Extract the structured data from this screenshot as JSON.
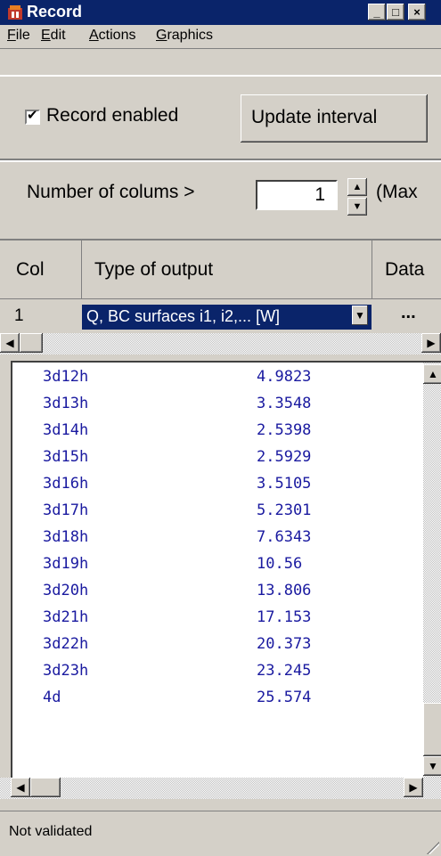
{
  "window": {
    "title": "Record",
    "min_btn": "_",
    "max_btn": "□",
    "close_btn": "×"
  },
  "menu": [
    {
      "label": "File",
      "accel": "F",
      "rest": "ile"
    },
    {
      "label": "Edit",
      "accel": "E",
      "rest": "dit"
    },
    {
      "label": "Actions",
      "accel": "A",
      "rest": "ctions"
    },
    {
      "label": "Graphics",
      "accel": "G",
      "rest": "raphics"
    }
  ],
  "record": {
    "enabled_label": "Record enabled",
    "enabled": true,
    "checkmark": "✔",
    "update_button": "Update interval"
  },
  "columns": {
    "label": "Number of colums  >",
    "value": "1",
    "max_label": "(Max"
  },
  "grid": {
    "headers": [
      "Col",
      "Type of output",
      "Data"
    ],
    "row": {
      "col": "1",
      "type": "Q, BC surfaces i1, i2,... [W]",
      "data": "..."
    }
  },
  "output": [
    {
      "k": "3d12h",
      "v": "4.9823"
    },
    {
      "k": "3d13h",
      "v": "3.3548"
    },
    {
      "k": "3d14h",
      "v": "2.5398"
    },
    {
      "k": "3d15h",
      "v": "2.5929"
    },
    {
      "k": "3d16h",
      "v": "3.5105"
    },
    {
      "k": "3d17h",
      "v": "5.2301"
    },
    {
      "k": "3d18h",
      "v": "7.6343"
    },
    {
      "k": "3d19h",
      "v": "10.56"
    },
    {
      "k": "3d20h",
      "v": "13.806"
    },
    {
      "k": "3d21h",
      "v": "17.153"
    },
    {
      "k": "3d22h",
      "v": "20.373"
    },
    {
      "k": "3d23h",
      "v": "23.245"
    },
    {
      "k": "4d",
      "v": "25.574"
    }
  ],
  "status": {
    "text": "Not validated"
  }
}
